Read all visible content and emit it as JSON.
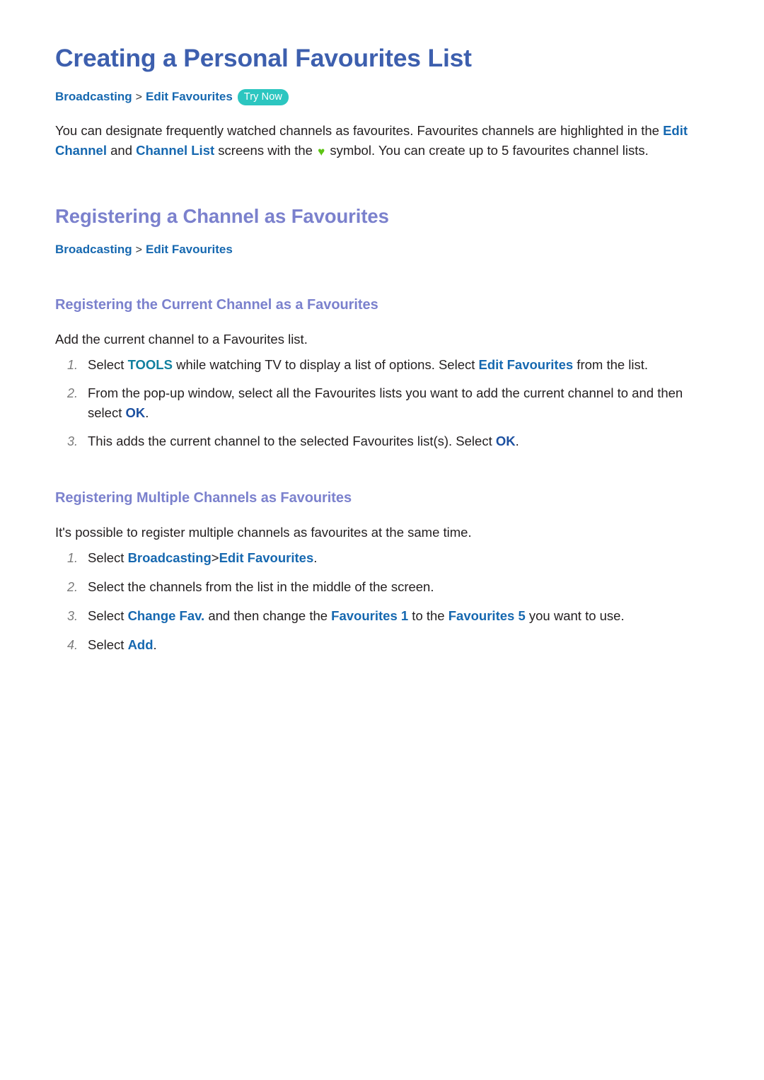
{
  "document": {
    "title": "Creating a Personal Favourites List",
    "breadcrumb_top": {
      "crumb1": "Broadcasting",
      "separator": ">",
      "crumb2": "Edit Favourites",
      "badge": "Try Now"
    },
    "intro": {
      "part1": "You can designate frequently watched channels as favourites. Favourites channels are highlighted in the ",
      "link1": "Edit Channel",
      "part2": " and ",
      "link2": "Channel List",
      "part3": " screens with the ",
      "heart_icon": "♥",
      "part4": " symbol. You can create up to 5 favourites channel lists."
    }
  },
  "section1": {
    "heading": "Registering a Channel as Favourites",
    "breadcrumb": {
      "crumb1": "Broadcasting",
      "separator": ">",
      "crumb2": "Edit Favourites"
    },
    "subsection1": {
      "heading": "Registering the Current Channel as a Favourites",
      "intro": "Add the current channel to a Favourites list.",
      "steps": [
        {
          "num": "1.",
          "p1": "Select ",
          "k1": "TOOLS",
          "p2": " while watching TV to display a list of options. Select ",
          "k2": "Edit Favourites",
          "p3": " from the list."
        },
        {
          "num": "2.",
          "p1": "From the pop-up window, select all the Favourites lists you want to add the current channel to and then select ",
          "k1": "OK",
          "p2": "."
        },
        {
          "num": "3.",
          "p1": "This adds the current channel to the selected Favourites list(s). Select ",
          "k1": "OK",
          "p2": "."
        }
      ]
    },
    "subsection2": {
      "heading": "Registering Multiple Channels as Favourites",
      "intro": "It's possible to register multiple channels as favourites at the same time.",
      "steps": [
        {
          "num": "1.",
          "p1": "Select ",
          "k1": "Broadcasting",
          "sep": ">",
          "k2": "Edit Favourites",
          "p2": "."
        },
        {
          "num": "2.",
          "p1": "Select the channels from the list in the middle of the screen."
        },
        {
          "num": "3.",
          "p1": "Select ",
          "k1": "Change Fav.",
          "p2": " and then change the ",
          "k2": "Favourites 1",
          "p3": " to the ",
          "k3": "Favourites 5",
          "p4": " you want to use."
        },
        {
          "num": "4.",
          "p1": "Select ",
          "k1": "Add",
          "p2": "."
        }
      ]
    }
  },
  "colors": {
    "title_blue": "#3d5fae",
    "heading_periwinkle": "#7b81cd",
    "link_blue": "#1668b0",
    "link_deep_blue": "#1c50a0",
    "link_teal": "#11809f",
    "badge_teal": "#2cc6c0",
    "heart_green": "#5cc413",
    "body_text": "#231f20",
    "list_number_gray": "#7b7b7b"
  }
}
